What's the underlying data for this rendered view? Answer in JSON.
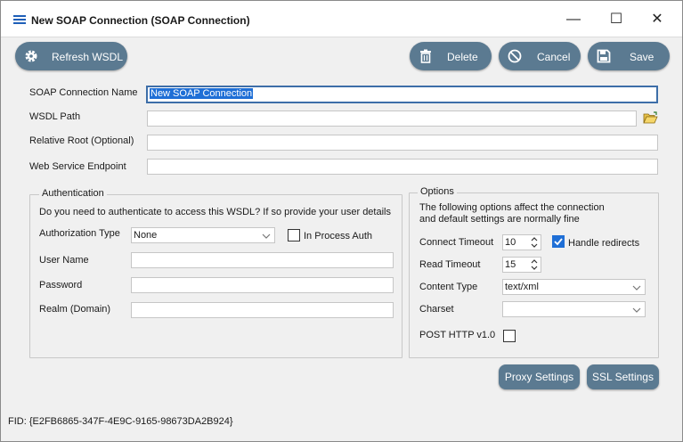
{
  "window": {
    "title": "New SOAP Connection (SOAP Connection)",
    "minimize": "—",
    "maximize": "☐",
    "close": "✕"
  },
  "toolbar": {
    "refresh_label": "Refresh WSDL",
    "delete_label": "Delete",
    "cancel_label": "Cancel",
    "save_label": "Save"
  },
  "form": {
    "name_label": "SOAP Connection Name",
    "name_value": "New SOAP Connection",
    "wsdl_label": "WSDL Path",
    "wsdl_value": "",
    "root_label": "Relative Root (Optional)",
    "root_value": "",
    "endpoint_label": "Web Service Endpoint",
    "endpoint_value": ""
  },
  "auth": {
    "legend": "Authentication",
    "prompt": "Do you need to authenticate to access this WSDL?  If so provide your user details",
    "type_label": "Authorization Type",
    "type_value": "None",
    "inprocess_label": "In Process Auth",
    "inprocess_checked": false,
    "user_label": "User Name",
    "user_value": "",
    "password_label": "Password",
    "password_value": "",
    "realm_label": "Realm (Domain)",
    "realm_value": ""
  },
  "options": {
    "legend": "Options",
    "desc_line1": "The following options affect the connection",
    "desc_line2": "and default settings are normally fine",
    "connect_timeout_label": "Connect Timeout",
    "connect_timeout_value": "10",
    "handle_redirects_label": "Handle redirects",
    "handle_redirects_checked": true,
    "read_timeout_label": "Read Timeout",
    "read_timeout_value": "15",
    "content_type_label": "Content Type",
    "content_type_value": "text/xml",
    "charset_label": "Charset",
    "charset_value": "",
    "post_http_label": "POST HTTP v1.0",
    "post_http_checked": false
  },
  "buttons": {
    "proxy_label": "Proxy Settings",
    "ssl_label": "SSL Settings"
  },
  "footer": {
    "fid": "FID: {E2FB6865-347F-4E9C-9165-98673DA2B924}"
  },
  "colors": {
    "button_bg": "#5b7a91",
    "accent": "#1f6fd6"
  }
}
